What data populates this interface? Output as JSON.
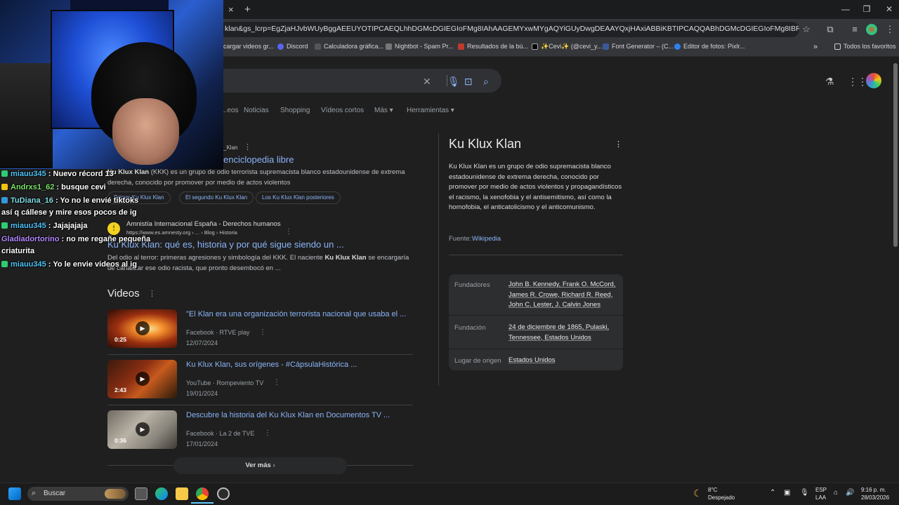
{
  "browser": {
    "address": "klan&gs_lcrp=EgZjaHJvbWUyBggAEEUYOTIPCAEQLhhDGMcDGIEGIoFMg8IAhAAGEMYxwMYgAQYiGUyDwgDEAAYQxjHAxiABBiKBTIPCAQQABhDGMcDGIEGIoFMg8IBRAAGEMYxwMYgAQYiUyC...",
    "bookmarks": [
      {
        "label": "cargar videos gr...",
        "color": "#e8453c"
      },
      {
        "label": "Discord",
        "color": "#5865f2"
      },
      {
        "label": "Calculadora gráfica...",
        "color": "#2f2f2f"
      },
      {
        "label": "Nightbot - Spam Pr...",
        "color": "#444444"
      },
      {
        "label": "Resultados de la bú...",
        "color": "#c0392b"
      },
      {
        "label": "✨Cevi✨ (@cevi_y...",
        "color": "#111111"
      },
      {
        "label": "Font Generator – (C...",
        "color": "#3b5998"
      },
      {
        "label": "Editor de fotos: Pixlr...",
        "color": "#2f80ed"
      }
    ],
    "all_favorites": "Todos los favoritos",
    "new_tab": "+",
    "close_tab": "×"
  },
  "search": {
    "tabs": [
      "...eos",
      "Noticias",
      "Shopping",
      "Vídeos cortos",
      "Más",
      "Herramientas"
    ]
  },
  "chat": [
    {
      "user": "miauu345",
      "msg": "Nuevo récord 13",
      "color": "#4fc3f7"
    },
    {
      "user": "Andrxs1_62",
      "msg": "busque cevi",
      "color": "#7ce36b"
    },
    {
      "user": "TuDiana_16",
      "msg": "Yo no le envié tiktoks",
      "color": "#80deea"
    },
    {
      "user": "",
      "msg": "así q cállese y mire esos pocos de ig",
      "color": "#ffffff"
    },
    {
      "user": "miauu345",
      "msg": "Jajajajaja",
      "color": "#4fc3f7"
    },
    {
      "user": "Gladiadortorino",
      "msg": "no me regañe pequeña",
      "color": "#b388ff"
    },
    {
      "user": "",
      "msg": "criaturita",
      "color": "#ffffff"
    },
    {
      "user": "miauu345",
      "msg": "Yo le envie videos al ig",
      "color": "#4fc3f7"
    }
  ],
  "result1": {
    "breadcrumb": "_Klan",
    "title": "enciclopedia libre",
    "snippet_a": "Ku Klux Klan",
    "snippet_b": " (KKK) es un grupo de odio terrorista supremacista blanco estadounidense de extrema",
    "snippet_c": "derecha, conocido por promover por medio de actos violentos",
    "chips": [
      "Primer Ku Klux Klan",
      "El segundo Ku Klux Klan",
      "Los Ku Klux Klan posteriores"
    ]
  },
  "result2": {
    "site": "Amnistía Internacional España - Derechos humanos",
    "url": "https://www.es.amnesty.org › ... › Blog › Historia",
    "title": "Ku Klux Klan: qué es, historia y por qué sigue siendo un ...",
    "snippet_a": "Del odio al terror: primeras agresiones y simbología del KKK. El naciente ",
    "snippet_b": "Ku Klux Klan",
    "snippet_c": " se encargaría",
    "snippet_d": "de canalizar ese odio racista, que pronto desembocó en ..."
  },
  "videos": {
    "heading": "Videos",
    "items": [
      {
        "title": "\"El Klan era una organización terrorista nacional que usaba el ...",
        "source": "Facebook · RTVE play",
        "date": "12/07/2024",
        "duration": "0:25"
      },
      {
        "title": "Ku Klux Klan, sus orígenes - #CápsulaHistórica ...",
        "source": "YouTube · Rompeviento TV",
        "date": "19/01/2024",
        "duration": "2:43"
      },
      {
        "title": "Descubre la historia del Ku Klux Klan en Documentos TV ...",
        "source": "Facebook · La 2 de TVE",
        "date": "17/01/2024",
        "duration": "0:36"
      }
    ],
    "more": "Ver más"
  },
  "panel": {
    "title": "Ku Klux Klan",
    "description": "Ku Klux Klan es un grupo de odio supremacista blanco estadounidense de extrema derecha, conocido por promover por medio de actos violentos y propagandísticos el racismo, la xenofobia y el antisemitismo, así como la homofobia, el anticatolicismo y el anticomunismo.",
    "source_label": "Fuente:",
    "source_link": "Wikipedia",
    "facts": [
      {
        "label": "Fundadores",
        "value": "John B. Kennedy, Frank O. McCord, James R. Crowe, Richard R. Reed, John C. Lester, J. Calvin Jones"
      },
      {
        "label": "Fundación",
        "value": "24 de diciembre de 1865, Pulaski, Tennessee, Estados Unidos"
      },
      {
        "label": "Lugar de origen",
        "value": "Estados Unidos"
      }
    ]
  },
  "taskbar": {
    "search": "Buscar",
    "weather_temp": "8°C",
    "weather_desc": "Despejado",
    "lang_a": "ESP",
    "lang_b": "LAA",
    "time": "9:16 p. m.",
    "date": "28/03/2026"
  }
}
